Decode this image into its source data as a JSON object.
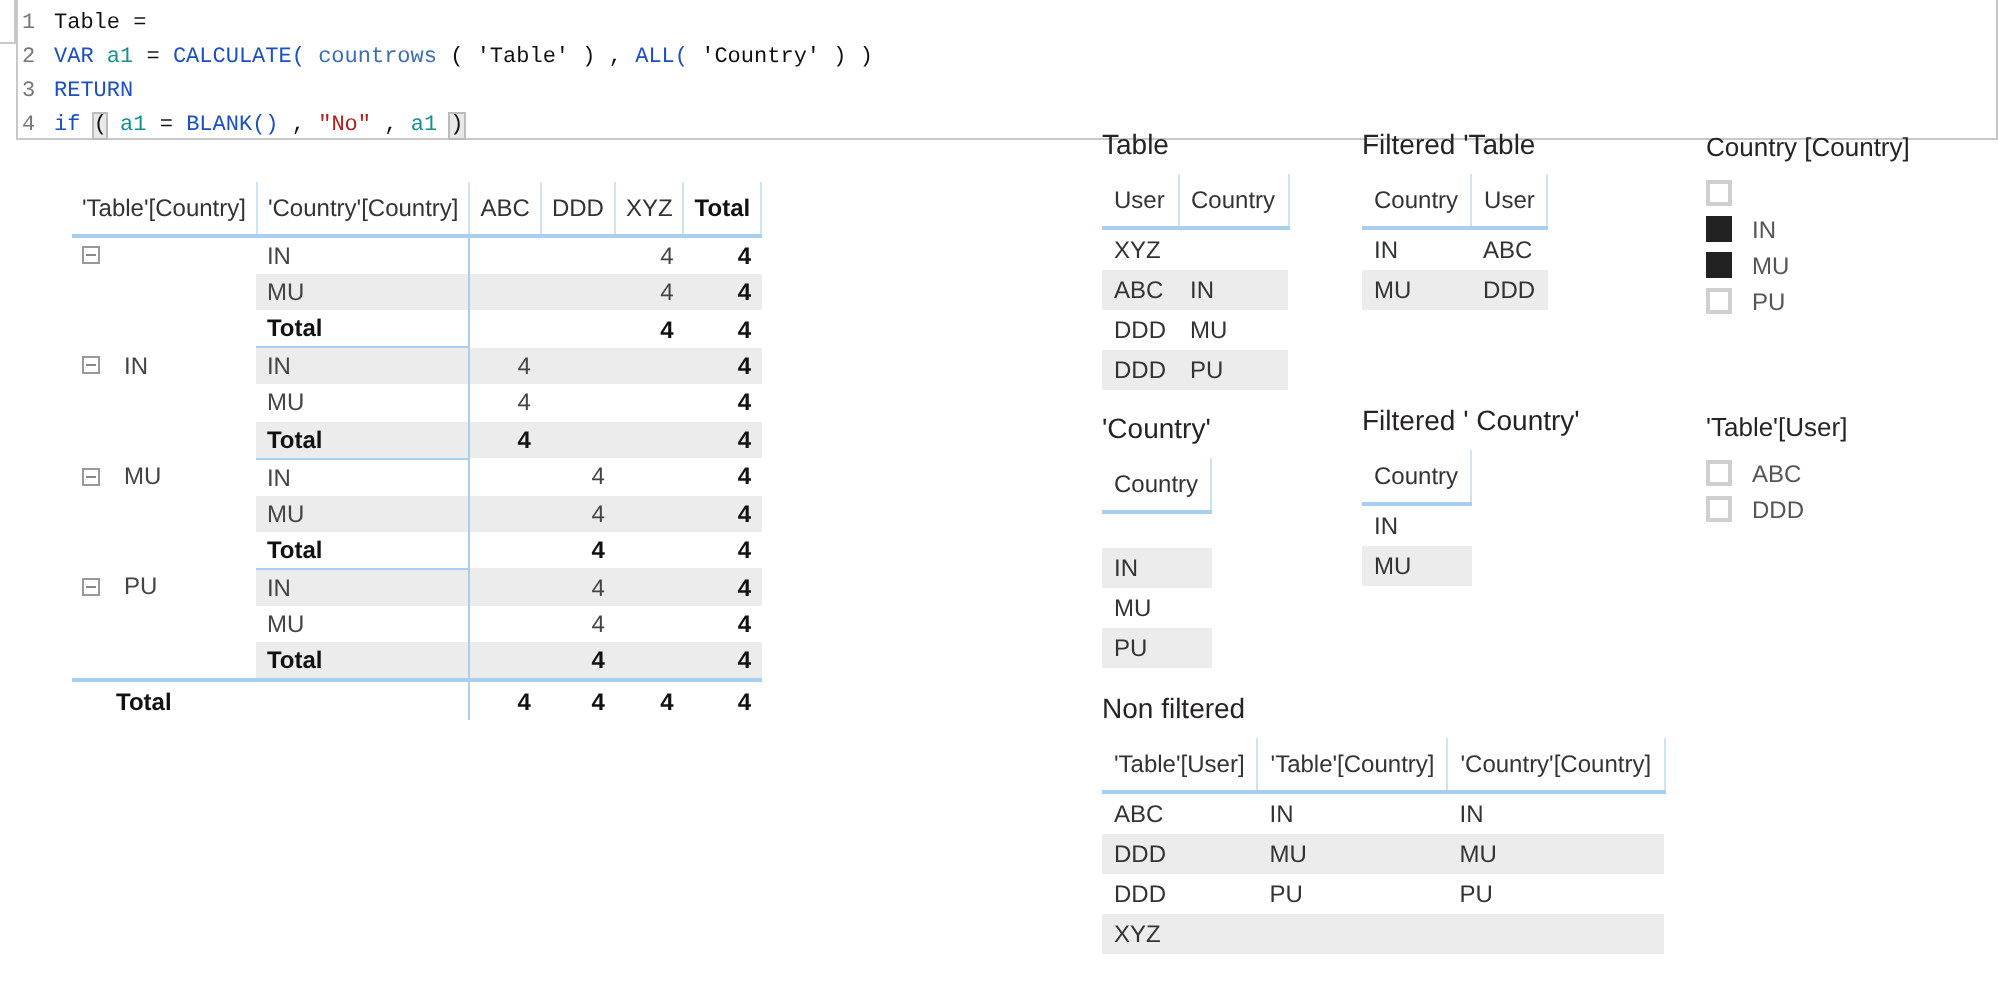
{
  "formula_bar": {
    "lines": [
      {
        "number": "1",
        "tokens": [
          {
            "text": "Table =",
            "kind": "plain"
          }
        ]
      },
      {
        "number": "2",
        "tokens": [
          {
            "text": "VAR",
            "kind": "keyword"
          },
          {
            "text": "a1",
            "kind": "variable"
          },
          {
            "text": "=",
            "kind": "plain"
          },
          {
            "text": "CALCULATE(",
            "kind": "keyword"
          },
          {
            "text": "countrows",
            "kind": "function"
          },
          {
            "text": "(",
            "kind": "plain"
          },
          {
            "text": "'Table'",
            "kind": "plain"
          },
          {
            "text": ")",
            "kind": "plain"
          },
          {
            "text": ",",
            "kind": "plain"
          },
          {
            "text": "ALL(",
            "kind": "keyword"
          },
          {
            "text": "'Country'",
            "kind": "plain"
          },
          {
            "text": ")",
            "kind": "plain"
          },
          {
            "text": ")",
            "kind": "plain"
          }
        ]
      },
      {
        "number": "3",
        "tokens": [
          {
            "text": "RETURN",
            "kind": "keyword"
          }
        ]
      },
      {
        "number": "4",
        "tokens": [
          {
            "text": "if",
            "kind": "keyword"
          },
          {
            "text": "(",
            "kind": "bracket"
          },
          {
            "text": "a1",
            "kind": "variable"
          },
          {
            "text": "=",
            "kind": "plain"
          },
          {
            "text": "BLANK()",
            "kind": "keyword"
          },
          {
            "text": ",",
            "kind": "plain"
          },
          {
            "text": "\"No\"",
            "kind": "string"
          },
          {
            "text": ",",
            "kind": "plain"
          },
          {
            "text": "a1",
            "kind": "variable"
          },
          {
            "text": ")",
            "kind": "bracket"
          }
        ]
      }
    ]
  },
  "matrix": {
    "columns": [
      {
        "label": "'Table'[Country]",
        "kind": "row"
      },
      {
        "label": "'Country'[Country]",
        "kind": "row"
      },
      {
        "label": "ABC",
        "kind": "value"
      },
      {
        "label": "DDD",
        "kind": "value"
      },
      {
        "label": "XYZ",
        "kind": "value"
      },
      {
        "label": "Total",
        "kind": "total"
      }
    ],
    "groups": [
      {
        "expanded": true,
        "rows": [
          {
            "label": "IN",
            "kind": "detail",
            "values": {
              "column_5": "4",
              "column_6": "4"
            }
          },
          {
            "label": "MU",
            "kind": "detail",
            "values": {
              "column_5": "4",
              "column_6": "4"
            }
          },
          {
            "label": "Total",
            "kind": "total",
            "values": {
              "column_5": "4",
              "column_6": "4"
            }
          }
        ]
      },
      {
        "label": "IN",
        "expanded": true,
        "rows": [
          {
            "label": "IN",
            "kind": "detail",
            "values": {
              "column_3": "4",
              "column_6": "4"
            }
          },
          {
            "label": "MU",
            "kind": "detail",
            "values": {
              "column_3": "4",
              "column_6": "4"
            }
          },
          {
            "label": "Total",
            "kind": "total",
            "values": {
              "column_3": "4",
              "column_6": "4"
            }
          }
        ]
      },
      {
        "label": "MU",
        "expanded": true,
        "rows": [
          {
            "label": "IN",
            "kind": "detail",
            "values": {
              "column_4": "4",
              "column_6": "4"
            }
          },
          {
            "label": "MU",
            "kind": "detail",
            "values": {
              "column_4": "4",
              "column_6": "4"
            }
          },
          {
            "label": "Total",
            "kind": "total",
            "values": {
              "column_4": "4",
              "column_6": "4"
            }
          }
        ]
      },
      {
        "label": "PU",
        "expanded": true,
        "rows": [
          {
            "label": "IN",
            "kind": "detail",
            "values": {
              "column_4": "4",
              "column_6": "4"
            }
          },
          {
            "label": "MU",
            "kind": "detail",
            "values": {
              "column_4": "4",
              "column_6": "4"
            }
          },
          {
            "label": "Total",
            "kind": "total",
            "values": {
              "column_4": "4",
              "column_6": "4"
            }
          }
        ]
      }
    ],
    "grand_total": {
      "label": "Total",
      "values": {
        "column_3": "4",
        "column_4": "4",
        "column_5": "4",
        "column_6": "4"
      }
    }
  },
  "visuals": [
    {
      "kind": "table",
      "title": "Table",
      "columns": [
        "User",
        "Country"
      ],
      "rows": [
        {
          "kind": "data",
          "cells": {
            "column_1": "XYZ"
          }
        },
        {
          "kind": "data",
          "cells": {
            "column_1": "ABC",
            "column_2": "IN"
          }
        },
        {
          "kind": "data",
          "cells": {
            "column_1": "DDD",
            "column_2": "MU"
          }
        },
        {
          "kind": "data",
          "cells": {
            "column_1": "DDD",
            "column_2": "PU"
          }
        }
      ]
    },
    {
      "kind": "table",
      "title": "Filtered 'Table",
      "columns": [
        "Country",
        "User"
      ],
      "rows": [
        {
          "kind": "data",
          "cells": {
            "column_1": "IN",
            "column_2": "ABC"
          }
        },
        {
          "kind": "data",
          "cells": {
            "column_1": "MU",
            "column_2": "DDD"
          }
        }
      ]
    },
    {
      "kind": "slicer",
      "title": "Country [Country]",
      "items": [
        {
          "checked": false
        },
        {
          "label": "IN",
          "checked": true
        },
        {
          "label": "MU",
          "checked": true
        },
        {
          "label": "PU",
          "checked": false
        }
      ]
    },
    {
      "kind": "table",
      "title": "'Country'",
      "columns": [
        "Country"
      ],
      "rows": [
        {
          "kind": "blank"
        },
        {
          "kind": "data",
          "cells": {
            "column_1": "IN"
          }
        },
        {
          "kind": "data",
          "cells": {
            "column_1": "MU"
          }
        },
        {
          "kind": "data",
          "cells": {
            "column_1": "PU"
          }
        }
      ]
    },
    {
      "kind": "table",
      "title": "Filtered ' Country'",
      "columns": [
        "Country"
      ],
      "rows": [
        {
          "kind": "data",
          "cells": {
            "column_1": "IN"
          }
        },
        {
          "kind": "data",
          "cells": {
            "column_1": "MU"
          }
        }
      ]
    },
    {
      "kind": "slicer",
      "title": "'Table'[User]",
      "items": [
        {
          "label": "ABC",
          "checked": false
        },
        {
          "label": "DDD",
          "checked": false
        }
      ]
    },
    {
      "kind": "table",
      "title": "Non filtered",
      "columns": [
        "'Table'[User]",
        "'Table'[Country]",
        "'Country'[Country]"
      ],
      "rows": [
        {
          "kind": "data",
          "cells": {
            "column_1": "ABC",
            "column_2": "IN",
            "column_3": "IN"
          }
        },
        {
          "kind": "data",
          "cells": {
            "column_1": "DDD",
            "column_2": "MU",
            "column_3": "MU"
          }
        },
        {
          "kind": "data",
          "cells": {
            "column_1": "DDD",
            "column_2": "PU",
            "column_3": "PU"
          }
        },
        {
          "kind": "data",
          "cells": {
            "column_1": "XYZ"
          }
        }
      ]
    }
  ]
}
